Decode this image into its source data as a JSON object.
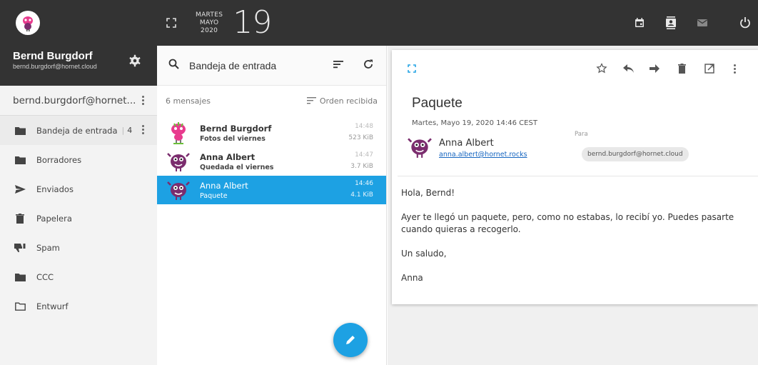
{
  "topbar": {
    "date": {
      "weekday": "MARTES",
      "month": "MAYO",
      "year": "2020",
      "day": "19"
    }
  },
  "sidebar": {
    "user": {
      "name": "Bernd Burgdorf",
      "email": "bernd.burgdorf@hornet.cloud"
    },
    "account_label": "bernd.burgdorf@hornet...",
    "folders": [
      {
        "label": "Bandeja de entrada",
        "badge": "4",
        "icon": "inbox-icon"
      },
      {
        "label": "Borradores",
        "icon": "folder-icon"
      },
      {
        "label": "Enviados",
        "icon": "send-icon"
      },
      {
        "label": "Papelera",
        "icon": "trash-icon"
      },
      {
        "label": "Spam",
        "icon": "thumb-down-icon"
      },
      {
        "label": "CCC",
        "icon": "folder-icon"
      },
      {
        "label": "Entwurf",
        "icon": "folder-outline-icon"
      }
    ]
  },
  "list": {
    "title": "Bandeja de entrada",
    "count_text": "6 mensajes",
    "sort_label": "Orden recibida",
    "messages": [
      {
        "from": "Bernd Burgdorf",
        "subject": "Fotos del viernes",
        "time": "14:48",
        "size": "523 KiB"
      },
      {
        "from": "Anna Albert",
        "subject": "Quedada el viernes",
        "time": "14:47",
        "size": "3.7 KiB"
      },
      {
        "from": "Anna Albert",
        "subject": "Paquete",
        "time": "14:46",
        "size": "4.1 KiB"
      }
    ]
  },
  "reader": {
    "subject": "Paquete",
    "date": "Martes, Mayo 19, 2020 14:46 CEST",
    "from_name": "Anna Albert",
    "from_email": "anna.albert@hornet.rocks",
    "to_label": "Para",
    "to_email": "bernd.burgdorf@hornet.cloud",
    "body": [
      "Hola, Bernd!",
      "Ayer te llegó un paquete, pero, como no estabas, lo recibí yo. Puedes pasarte cuando quieras a recogerlo.",
      "Un saludo,",
      "Anna"
    ]
  },
  "colors": {
    "accent": "#1da1e3",
    "dark": "#333333",
    "sidebar": "#f3f3f3"
  }
}
